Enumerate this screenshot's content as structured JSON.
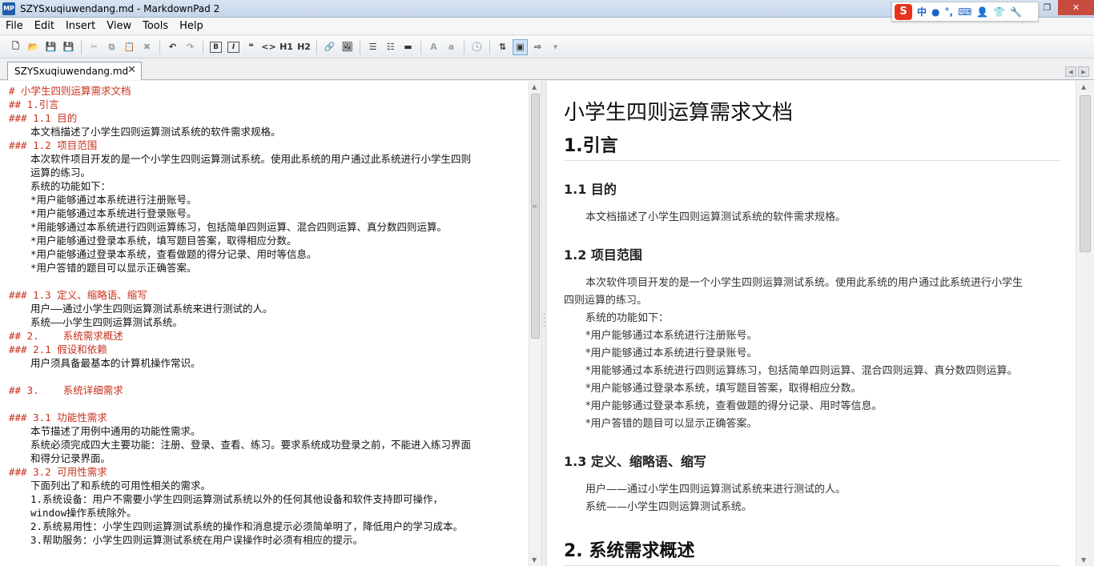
{
  "window": {
    "title": "SZYSxuqiuwendang.md - MarkdownPad 2",
    "app_icon": "MP",
    "ime": {
      "logo": "S",
      "items": [
        "中",
        "●",
        "°,",
        "⌨",
        "👤",
        "👕",
        "🔧"
      ]
    }
  },
  "menu": [
    "File",
    "Edit",
    "Insert",
    "View",
    "Tools",
    "Help"
  ],
  "toolbar": {
    "h1_label": "H1",
    "h2_label": "H2",
    "bold_label": "B",
    "italic_label": "I",
    "quote_label": "❝",
    "code_label": "<>",
    "font_up_label": "A",
    "font_down_label": "a"
  },
  "tab": {
    "label": "SZYSxuqiuwendang.md",
    "close": "✕"
  },
  "editor": {
    "lines": [
      {
        "t": "h",
        "text": "# 小学生四则运算需求文档"
      },
      {
        "t": "h",
        "text": "## 1.引言"
      },
      {
        "t": "h",
        "text": "### 1.1 目的"
      },
      {
        "t": "x",
        "text": "本文档描述了小学生四则运算测试系统的软件需求规格。"
      },
      {
        "t": "h",
        "text": "### 1.2 项目范围"
      },
      {
        "t": "x",
        "text": "本次软件项目开发的是一个小学生四则运算测试系统。使用此系统的用户通过此系统进行小学生四则"
      },
      {
        "t": "x",
        "text": "运算的练习。"
      },
      {
        "t": "x",
        "text": "系统的功能如下："
      },
      {
        "t": "x",
        "text": "*用户能够通过本系统进行注册账号。"
      },
      {
        "t": "x",
        "text": "*用户能够通过本系统进行登录账号。"
      },
      {
        "t": "x",
        "text": "*用能够通过本系统进行四则运算练习，包括简单四则运算、混合四则运算、真分数四则运算。"
      },
      {
        "t": "x",
        "text": "*用户能够通过登录本系统，填写题目答案，取得相应分数。"
      },
      {
        "t": "x",
        "text": "*用户能够通过登录本系统，查看做题的得分记录、用时等信息。"
      },
      {
        "t": "x",
        "text": "*用户答错的题目可以显示正确答案。"
      },
      {
        "t": "b",
        "text": ""
      },
      {
        "t": "h",
        "text": "### 1.3 定义、缩略语、缩写"
      },
      {
        "t": "x",
        "text": "用户——通过小学生四则运算测试系统来进行测试的人。"
      },
      {
        "t": "x",
        "text": "系统——小学生四则运算测试系统。"
      },
      {
        "t": "h",
        "text": "## 2.    系统需求概述"
      },
      {
        "t": "h",
        "text": "### 2.1 假设和依赖"
      },
      {
        "t": "x",
        "text": "用户须具备最基本的计算机操作常识。"
      },
      {
        "t": "b",
        "text": ""
      },
      {
        "t": "h",
        "text": "## 3.    系统详细需求"
      },
      {
        "t": "b",
        "text": ""
      },
      {
        "t": "h",
        "text": "### 3.1 功能性需求"
      },
      {
        "t": "x",
        "text": "本节描述了用例中通用的功能性需求。"
      },
      {
        "t": "x",
        "text": "系统必须完成四大主要功能：注册、登录、查看、练习。要求系统成功登录之前，不能进入练习界面"
      },
      {
        "t": "x",
        "text": "和得分记录界面。"
      },
      {
        "t": "h",
        "text": "### 3.2 可用性需求"
      },
      {
        "t": "x",
        "text": "下面列出了和系统的可用性相关的需求。"
      },
      {
        "t": "x",
        "text": "1.系统设备：用户不需要小学生四则运算测试系统以外的任何其他设备和软件支持即可操作，"
      },
      {
        "t": "x",
        "text": "window操作系统除外。"
      },
      {
        "t": "x",
        "text": "2.系统易用性：小学生四则运算测试系统的操作和消息提示必须简单明了，降低用户的学习成本。"
      },
      {
        "t": "x",
        "text": "3.帮助服务：小学生四则运算测试系统在用户误操作时必须有相应的提示。"
      }
    ]
  },
  "preview": {
    "h1": "小学生四则运算需求文档",
    "sec1": "1.引言",
    "s11": "1.1 目的",
    "s11_p": "本文档描述了小学生四则运算测试系统的软件需求规格。",
    "s12": "1.2 项目范围",
    "s12_p1a": "本次软件项目开发的是一个小学生四则运算测试系统。使用此系统的用户通过此系统进行小学生",
    "s12_p1b": "四则运算的练习。",
    "s12_lines": [
      "系统的功能如下：",
      "*用户能够通过本系统进行注册账号。",
      "*用户能够通过本系统进行登录账号。",
      "*用能够通过本系统进行四则运算练习，包括简单四则运算、混合四则运算、真分数四则运算。",
      "*用户能够通过登录本系统，填写题目答案，取得相应分数。",
      "*用户能够通过登录本系统，查看做题的得分记录、用时等信息。",
      "*用户答错的题目可以显示正确答案。"
    ],
    "s13": "1.3 定义、缩略语、缩写",
    "s13_lines": [
      "用户——通过小学生四则运算测试系统来进行测试的人。",
      "系统——小学生四则运算测试系统。"
    ],
    "sec2": "2. 系统需求概述"
  }
}
